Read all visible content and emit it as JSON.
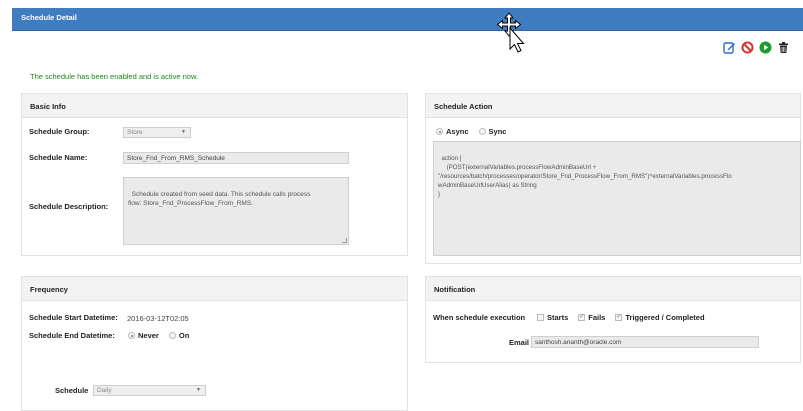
{
  "header": {
    "title": "Schedule Detail"
  },
  "toolbar": {
    "icons": [
      "edit-icon",
      "disable-icon",
      "run-icon",
      "delete-icon"
    ]
  },
  "status_message": "The schedule has been enabled and is active now.",
  "basic_info": {
    "heading": "Basic Info",
    "group_label": "Schedule Group:",
    "group_value": "Store",
    "name_label": "Schedule Name:",
    "name_value": "Store_Fnd_From_RMS_Schedule",
    "description_label": "Schedule Description:",
    "description_value": "Schedule created from seed data. This schedule calls process\nflow: Store_Fnd_ProcessFlow_From_RMS."
  },
  "schedule_action": {
    "heading": "Schedule Action",
    "async_label": "Async",
    "sync_label": "Sync",
    "code": "action {\n     (POST(externalVariables.processFlowAdminBaseUrl +\n\"/resources/batch/processes/operator/Store_Fnd_ProcessFlow_From_RMS\")^externalVariables.processFlo\nwAdminBaseUrlUserAlias) as String\n}"
  },
  "frequency": {
    "heading": "Frequency",
    "start_label": "Schedule Start Datetime:",
    "start_value": "2016-03-12T02:05",
    "end_label": "Schedule End Datetime:",
    "never_label": "Never",
    "on_label": "On",
    "schedule_label": "Schedule",
    "schedule_value": "Daily"
  },
  "notification": {
    "heading": "Notification",
    "when_label": "When schedule execution",
    "starts_label": "Starts",
    "fails_label": "Fails",
    "triggered_label": "Triggered / Completed",
    "email_label": "Email",
    "email_value": "santhosh.ananth@oracle.com"
  },
  "colors": {
    "header": "#3f7cc0",
    "success_text": "#1a8a1a",
    "edit": "#2a6fc2",
    "disable": "#d9332b",
    "run": "#1e9a2e",
    "delete": "#222222"
  }
}
